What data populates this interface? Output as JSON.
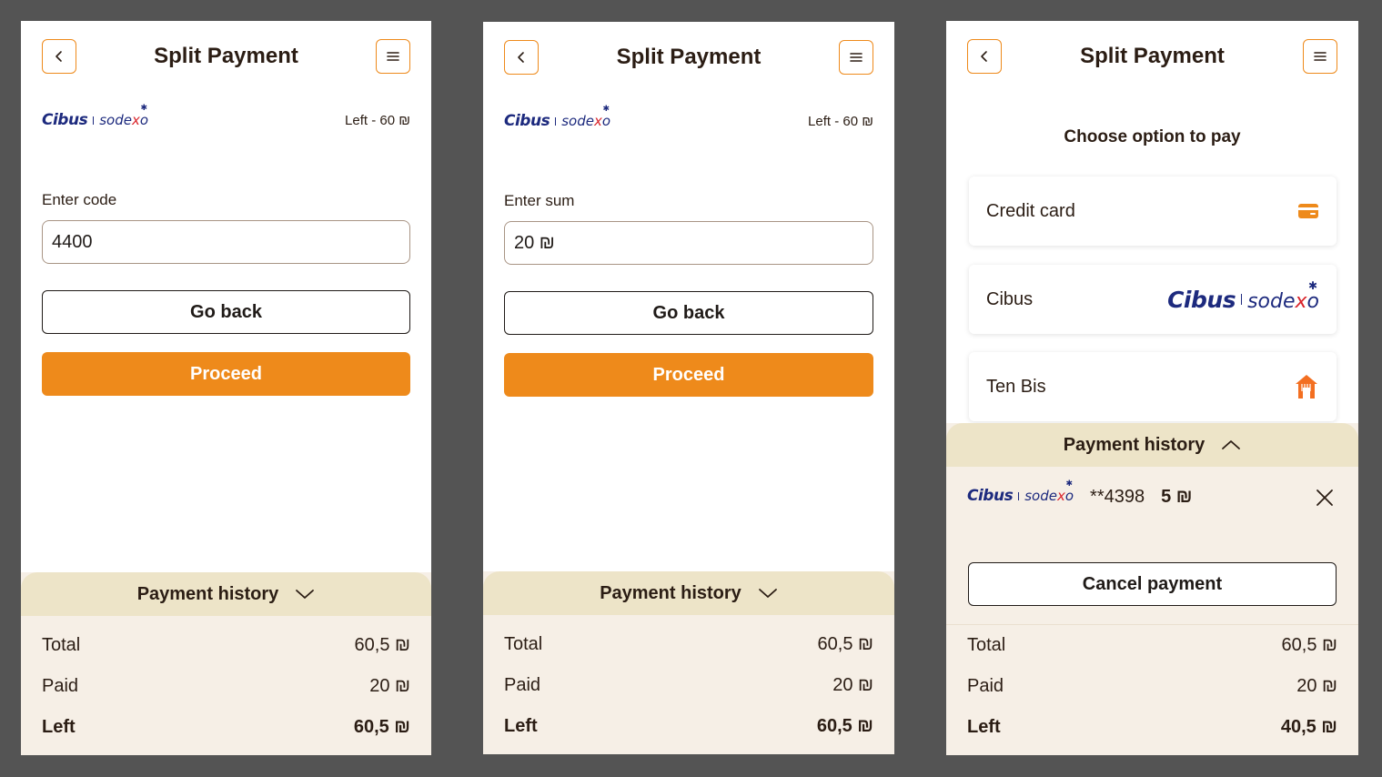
{
  "screens": [
    {
      "header": {
        "title": "Split Payment",
        "back_icon": "chevron-left-icon",
        "menu_icon": "hamburger-menu-icon"
      },
      "brand": {
        "cibus": "Cibus",
        "sodexo": "sodexo",
        "left_info": "Left - 60 ₪"
      },
      "field": {
        "label": "Enter code",
        "value": "4400"
      },
      "go_back": "Go back",
      "proceed": "Proceed",
      "history": {
        "title": "Payment history",
        "rows": [
          {
            "label": "Total",
            "value": "60,5 ₪"
          },
          {
            "label": "Paid",
            "value": "20 ₪"
          },
          {
            "label": "Left",
            "value": "60,5 ₪"
          }
        ]
      }
    },
    {
      "header": {
        "title": "Split Payment"
      },
      "brand": {
        "cibus": "Cibus",
        "sodexo": "sodexo",
        "left_info": "Left - 60 ₪"
      },
      "field": {
        "label": "Enter sum",
        "value": "20 ₪"
      },
      "go_back": "Go back",
      "proceed": "Proceed",
      "history": {
        "title": "Payment history",
        "rows": [
          {
            "label": "Total",
            "value": "60,5 ₪"
          },
          {
            "label": "Paid",
            "value": "20 ₪"
          },
          {
            "label": "Left",
            "value": "60,5 ₪"
          }
        ]
      }
    },
    {
      "header": {
        "title": "Split Payment"
      },
      "choose_title": "Choose option to pay",
      "options": [
        {
          "label": "Credit card",
          "icon": "credit-card-icon"
        },
        {
          "label": "Cibus",
          "icon": "cibus-sodexo-logo"
        },
        {
          "label": "Ten Bis",
          "icon": "tenbis-logo-icon"
        }
      ],
      "history": {
        "title": "Payment history",
        "payment": {
          "cibus": "Cibus",
          "sodexo": "sodexo",
          "card": "**4398",
          "amount": "5 ₪"
        },
        "cancel": "Cancel payment",
        "rows": [
          {
            "label": "Total",
            "value": "60,5 ₪"
          },
          {
            "label": "Paid",
            "value": "20 ₪"
          },
          {
            "label": "Left",
            "value": "40,5 ₪"
          }
        ]
      }
    }
  ],
  "colors": {
    "accent": "#ee8a1b",
    "brand_blue": "#1d2a7e",
    "history_header": "#ede4c8",
    "history_bg": "#f6efe6",
    "backdrop": "#545454"
  }
}
